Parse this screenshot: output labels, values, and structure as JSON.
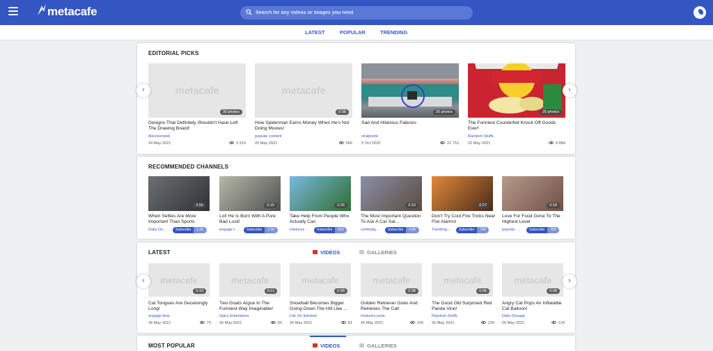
{
  "header": {
    "logo": "metacafe",
    "search_placeholder": "Search for any videos or images you need"
  },
  "subnav": {
    "items": [
      "LATEST",
      "POPULAR",
      "TRENDING"
    ]
  },
  "editorial": {
    "title": "EDITORIAL PICKS",
    "cards": [
      {
        "title": "Designs That Definitely Shouldn't Have Left The Drawing Board!",
        "source": "discoverweb",
        "date": "24 May 2021",
        "views": "3 319",
        "badge": "30 photos",
        "image": "placeholder"
      },
      {
        "title": "How Spiderman Earns Money When He's Not Doing Movies!",
        "source": "popular content",
        "date": "25 May 2021",
        "views": "566",
        "badge": "0:08",
        "image": "placeholder"
      },
      {
        "title": "Sad And Hilarious Failures",
        "source": "viralposte",
        "date": "5 Oct 2020",
        "views": "21 753",
        "badge": "30 photos",
        "image": "car"
      },
      {
        "title": "The Funniest Counterfeit Knock Off Goods Ever!",
        "source": "Random Stuffs",
        "date": "22 May 2021",
        "views": "9 884",
        "badge": "25 photos",
        "image": "chips"
      }
    ]
  },
  "channels": {
    "title": "RECOMMENDED CHANNELS",
    "subscribe_label": "Subscribe",
    "cards": [
      {
        "title": "When Selfies Are More Important Than Sports",
        "channel": "Daily Do…",
        "count": "1.1K",
        "badge": "0:55",
        "colors": [
          "#6c6f73",
          "#2f3236"
        ]
      },
      {
        "title": "Lol! He Is Born With A Pure Bad Luck!",
        "channel": "engage t…",
        "count": "1.1K",
        "badge": "0:15",
        "colors": [
          "#b7b8a8",
          "#4f5250"
        ]
      },
      {
        "title": "Take Help From People Who Actually Can",
        "channel": "mixtures …",
        "count": "919",
        "badge": "0:26",
        "colors": [
          "#79b7e0",
          "#2f6f2e"
        ]
      },
      {
        "title": "The Most Important Question To Ask A Car Sal…",
        "channel": "contentg…",
        "count": "3.3K",
        "badge": "0:10",
        "colors": [
          "#8a8fa8",
          "#5b4c3f"
        ]
      },
      {
        "title": "Don't Try Cool Fire Tricks Near Fire Alarms!",
        "channel": "Trending…",
        "count": "768",
        "badge": "0:27",
        "colors": [
          "#e08a3a",
          "#4a2a1a"
        ]
      },
      {
        "title": "Love For Food Gone To The Highest Level",
        "channel": "popular …",
        "count": "760",
        "badge": "0:18",
        "colors": [
          "#b89a8a",
          "#6e5048"
        ]
      }
    ]
  },
  "latest": {
    "title": "LATEST",
    "tab_videos": "VIDEOS",
    "tab_galleries": "GALLERIES",
    "cards": [
      {
        "title": "Cat Tongues Are Deceivingly Long!",
        "source": "engage time",
        "date": "26 May 2021",
        "views": "79",
        "badge": "0:10"
      },
      {
        "title": "Two Goats Argue In The Funniest Way Imaginable!",
        "source": "Spicy Entertainer",
        "date": "26 May 2021",
        "views": "90",
        "badge": "0:11"
      },
      {
        "title": "Snowball Becomes Bigger Going Down The Hill Like …",
        "source": "Life On listomet",
        "date": "26 May 2021",
        "views": "81",
        "badge": "0:08"
      },
      {
        "title": "Golden Retriever Goes And Retrieves The Cat!",
        "source": "mixtures zone",
        "date": "26 May 2021",
        "views": "109",
        "badge": "0:38"
      },
      {
        "title": "The Good Old Surprised Red Panda Vine!",
        "source": "Random Stuffs",
        "date": "26 May 2021",
        "views": "134",
        "badge": "0:06"
      },
      {
        "title": "Angry Cat Pops An Inflatable Cat Balloon!",
        "source": "Daily Dosage",
        "date": "26 May 2021",
        "views": "124",
        "badge": "0:08"
      }
    ]
  },
  "popular": {
    "title": "MOST POPULAR",
    "tab_videos": "VIDEOS",
    "tab_galleries": "GALLERIES"
  },
  "watermark": "metacafe"
}
